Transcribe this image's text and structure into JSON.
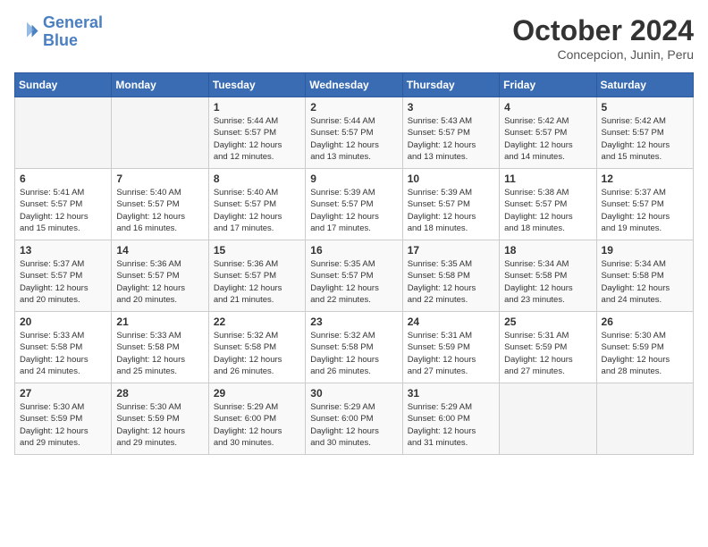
{
  "header": {
    "logo_line1": "General",
    "logo_line2": "Blue",
    "month": "October 2024",
    "location": "Concepcion, Junin, Peru"
  },
  "weekdays": [
    "Sunday",
    "Monday",
    "Tuesday",
    "Wednesday",
    "Thursday",
    "Friday",
    "Saturday"
  ],
  "weeks": [
    [
      {
        "day": "",
        "info": ""
      },
      {
        "day": "",
        "info": ""
      },
      {
        "day": "1",
        "info": "Sunrise: 5:44 AM\nSunset: 5:57 PM\nDaylight: 12 hours\nand 12 minutes."
      },
      {
        "day": "2",
        "info": "Sunrise: 5:44 AM\nSunset: 5:57 PM\nDaylight: 12 hours\nand 13 minutes."
      },
      {
        "day": "3",
        "info": "Sunrise: 5:43 AM\nSunset: 5:57 PM\nDaylight: 12 hours\nand 13 minutes."
      },
      {
        "day": "4",
        "info": "Sunrise: 5:42 AM\nSunset: 5:57 PM\nDaylight: 12 hours\nand 14 minutes."
      },
      {
        "day": "5",
        "info": "Sunrise: 5:42 AM\nSunset: 5:57 PM\nDaylight: 12 hours\nand 15 minutes."
      }
    ],
    [
      {
        "day": "6",
        "info": "Sunrise: 5:41 AM\nSunset: 5:57 PM\nDaylight: 12 hours\nand 15 minutes."
      },
      {
        "day": "7",
        "info": "Sunrise: 5:40 AM\nSunset: 5:57 PM\nDaylight: 12 hours\nand 16 minutes."
      },
      {
        "day": "8",
        "info": "Sunrise: 5:40 AM\nSunset: 5:57 PM\nDaylight: 12 hours\nand 17 minutes."
      },
      {
        "day": "9",
        "info": "Sunrise: 5:39 AM\nSunset: 5:57 PM\nDaylight: 12 hours\nand 17 minutes."
      },
      {
        "day": "10",
        "info": "Sunrise: 5:39 AM\nSunset: 5:57 PM\nDaylight: 12 hours\nand 18 minutes."
      },
      {
        "day": "11",
        "info": "Sunrise: 5:38 AM\nSunset: 5:57 PM\nDaylight: 12 hours\nand 18 minutes."
      },
      {
        "day": "12",
        "info": "Sunrise: 5:37 AM\nSunset: 5:57 PM\nDaylight: 12 hours\nand 19 minutes."
      }
    ],
    [
      {
        "day": "13",
        "info": "Sunrise: 5:37 AM\nSunset: 5:57 PM\nDaylight: 12 hours\nand 20 minutes."
      },
      {
        "day": "14",
        "info": "Sunrise: 5:36 AM\nSunset: 5:57 PM\nDaylight: 12 hours\nand 20 minutes."
      },
      {
        "day": "15",
        "info": "Sunrise: 5:36 AM\nSunset: 5:57 PM\nDaylight: 12 hours\nand 21 minutes."
      },
      {
        "day": "16",
        "info": "Sunrise: 5:35 AM\nSunset: 5:57 PM\nDaylight: 12 hours\nand 22 minutes."
      },
      {
        "day": "17",
        "info": "Sunrise: 5:35 AM\nSunset: 5:58 PM\nDaylight: 12 hours\nand 22 minutes."
      },
      {
        "day": "18",
        "info": "Sunrise: 5:34 AM\nSunset: 5:58 PM\nDaylight: 12 hours\nand 23 minutes."
      },
      {
        "day": "19",
        "info": "Sunrise: 5:34 AM\nSunset: 5:58 PM\nDaylight: 12 hours\nand 24 minutes."
      }
    ],
    [
      {
        "day": "20",
        "info": "Sunrise: 5:33 AM\nSunset: 5:58 PM\nDaylight: 12 hours\nand 24 minutes."
      },
      {
        "day": "21",
        "info": "Sunrise: 5:33 AM\nSunset: 5:58 PM\nDaylight: 12 hours\nand 25 minutes."
      },
      {
        "day": "22",
        "info": "Sunrise: 5:32 AM\nSunset: 5:58 PM\nDaylight: 12 hours\nand 26 minutes."
      },
      {
        "day": "23",
        "info": "Sunrise: 5:32 AM\nSunset: 5:58 PM\nDaylight: 12 hours\nand 26 minutes."
      },
      {
        "day": "24",
        "info": "Sunrise: 5:31 AM\nSunset: 5:59 PM\nDaylight: 12 hours\nand 27 minutes."
      },
      {
        "day": "25",
        "info": "Sunrise: 5:31 AM\nSunset: 5:59 PM\nDaylight: 12 hours\nand 27 minutes."
      },
      {
        "day": "26",
        "info": "Sunrise: 5:30 AM\nSunset: 5:59 PM\nDaylight: 12 hours\nand 28 minutes."
      }
    ],
    [
      {
        "day": "27",
        "info": "Sunrise: 5:30 AM\nSunset: 5:59 PM\nDaylight: 12 hours\nand 29 minutes."
      },
      {
        "day": "28",
        "info": "Sunrise: 5:30 AM\nSunset: 5:59 PM\nDaylight: 12 hours\nand 29 minutes."
      },
      {
        "day": "29",
        "info": "Sunrise: 5:29 AM\nSunset: 6:00 PM\nDaylight: 12 hours\nand 30 minutes."
      },
      {
        "day": "30",
        "info": "Sunrise: 5:29 AM\nSunset: 6:00 PM\nDaylight: 12 hours\nand 30 minutes."
      },
      {
        "day": "31",
        "info": "Sunrise: 5:29 AM\nSunset: 6:00 PM\nDaylight: 12 hours\nand 31 minutes."
      },
      {
        "day": "",
        "info": ""
      },
      {
        "day": "",
        "info": ""
      }
    ]
  ]
}
